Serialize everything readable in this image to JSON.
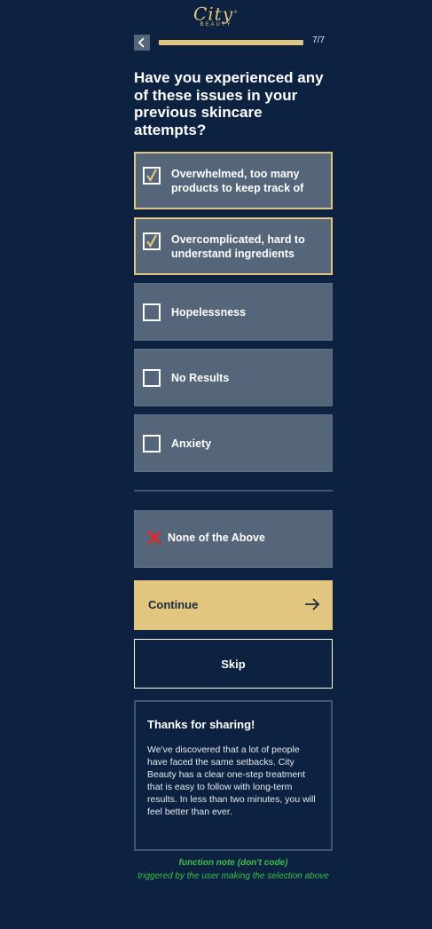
{
  "brand": {
    "logo_script": "City",
    "logo_sub": "BEAUTY",
    "registered_mark": "®",
    "gold": "#e2c57f",
    "background": "#0c2240"
  },
  "header": {
    "back_icon": "chevron-left-icon",
    "progress_fraction": 1.0,
    "step_count": "7/7"
  },
  "question": "Have you experienced any of these issues in your previous skincare attempts?",
  "options": [
    {
      "label": "Overwhelmed, too many products to keep track of",
      "selected": true
    },
    {
      "label": "Overcomplicated, hard to understand ingredients",
      "selected": true
    },
    {
      "label": "Hopelessness",
      "selected": false
    },
    {
      "label": "No Results",
      "selected": false
    },
    {
      "label": "Anxiety",
      "selected": false
    }
  ],
  "none_option": {
    "label": "None of the Above",
    "icon": "x-icon",
    "icon_color": "#e3262b"
  },
  "continue": {
    "label": "Continue",
    "icon": "arrow-right-icon"
  },
  "skip": {
    "label": "Skip"
  },
  "info": {
    "title": "Thanks for sharing!",
    "body": "We've discovered that a lot of people have faced the same setbacks. City Beauty has a clear one-step treatment that is easy to follow with long-term results. In less than two minutes, you will feel better than ever."
  },
  "note": {
    "title": "function note (don't code)",
    "text": "triggered by the user making the selection above",
    "color": "#3fbe4a"
  }
}
